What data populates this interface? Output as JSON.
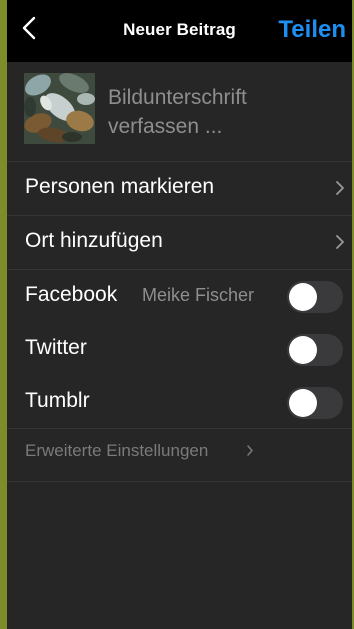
{
  "header": {
    "title": "Neuer Beitrag",
    "share_label": "Teilen",
    "back_icon": "chevron-left-icon"
  },
  "caption": {
    "placeholder_line1": "Bildunterschrift",
    "placeholder_line2": "verfassen ..."
  },
  "options": {
    "tag_people": "Personen markieren",
    "add_location": "Ort hinzufügen",
    "chevron_icon": "chevron-right-icon"
  },
  "share_targets": [
    {
      "label": "Facebook",
      "account": "Meike Fischer",
      "enabled": false
    },
    {
      "label": "Twitter",
      "enabled": false
    },
    {
      "label": "Tumblr",
      "enabled": false
    }
  ],
  "advanced": {
    "label": "Erweiterte Einstellungen"
  },
  "colors": {
    "accent": "#1d8ff0",
    "background": "#262626",
    "topbar": "#000000",
    "outer_frame": "#7f8c2a"
  }
}
